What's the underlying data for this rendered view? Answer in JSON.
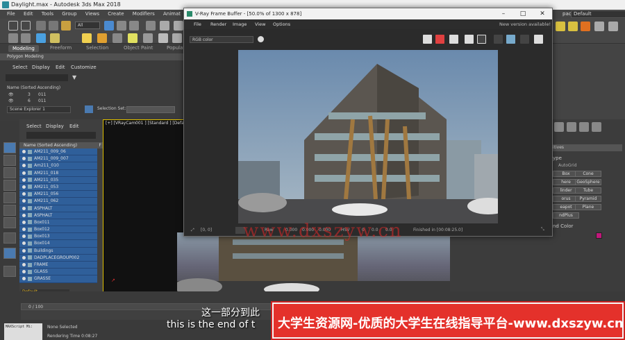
{
  "main_window": {
    "title": "Daylight.max - Autodesk 3ds Max 2018",
    "menu": [
      "File",
      "Edit",
      "Tools",
      "Group",
      "Views",
      "Create",
      "Modifiers",
      "Animat"
    ],
    "workspace_label": "paces:",
    "workspace_value": "Default",
    "selection_filter": "All"
  },
  "ribbon": {
    "tabs": [
      "Modeling",
      "Freeform",
      "Selection",
      "Object Paint",
      "Populat"
    ],
    "active_tab": "Modeling",
    "sub_label": "Polygon Modeling"
  },
  "explorer_top": {
    "menu": [
      "Select",
      "Display",
      "Edit",
      "Customize"
    ],
    "column_header": "Name (Sorted Ascending)",
    "rows": [
      {
        "num": "3",
        "name": "011"
      },
      {
        "num": "6",
        "name": "011"
      }
    ],
    "scene_explorer_label": "Scene Explorer 1",
    "selection_set_label": "Selection Set:"
  },
  "scene_explorer": {
    "menu": [
      "Select",
      "Display",
      "Edit"
    ],
    "column_header": "Name (Sorted Ascending)",
    "col_f": "F",
    "items": [
      "AM211_009_06",
      "AM211_009_007",
      "Am211_010",
      "AM211_018",
      "AM211_035",
      "AM211_053",
      "AM211_056",
      "AM211_062",
      "ASPHALT",
      "ASPHALT",
      "Box011",
      "Box012",
      "Box013",
      "Box014",
      "Buildings",
      "DADPLACEGROUP002",
      "FRAME",
      "GLASS",
      "GRASSE"
    ],
    "layer_value": "Default"
  },
  "viewport": {
    "label": "[+] [VRayCam001 ] [Standard ] [Defau"
  },
  "vfb": {
    "title": "V-Ray Frame Buffer - [50.0% of 1300 x 878]",
    "menu": [
      "File",
      "Render",
      "Image",
      "View",
      "Options"
    ],
    "notice": "New version available!",
    "channel": "RGB color",
    "coords": "[0, 0]",
    "status_mode": "Raw",
    "status_values": [
      "0.000",
      "0.000",
      "0.000"
    ],
    "status_mode2": "HSV",
    "status_values2": [
      "0",
      "0.0",
      "0.0"
    ],
    "status_tail": "Finished in [00:08:25.0]"
  },
  "right_panel": {
    "section_label": "itives",
    "type_label": "ype",
    "autogrid": "AutoGrid",
    "buttons": [
      "Box",
      "Cone",
      "here",
      "GeoSphere",
      "linder",
      "Tube",
      "orus",
      "Pyramid",
      "eapot",
      "Plane",
      "ndPlus"
    ],
    "name_color_label": "nd Color",
    "swatch": "#c0187a"
  },
  "bottom": {
    "timeline_label": "0 / 100",
    "status_none": "None Selected",
    "render_time": "Rendering Time  0:08:27",
    "maxscript": "MAXScript Mi:"
  },
  "subtitles": {
    "cn": "这一部分到此",
    "en": "this is the end of t"
  },
  "banner": {
    "text": "大学生资源网-优质的大学生在线指导平台-www.dxszyw.cn",
    "color": "#e4312b"
  },
  "watermark": "www.dxszyw.cn"
}
